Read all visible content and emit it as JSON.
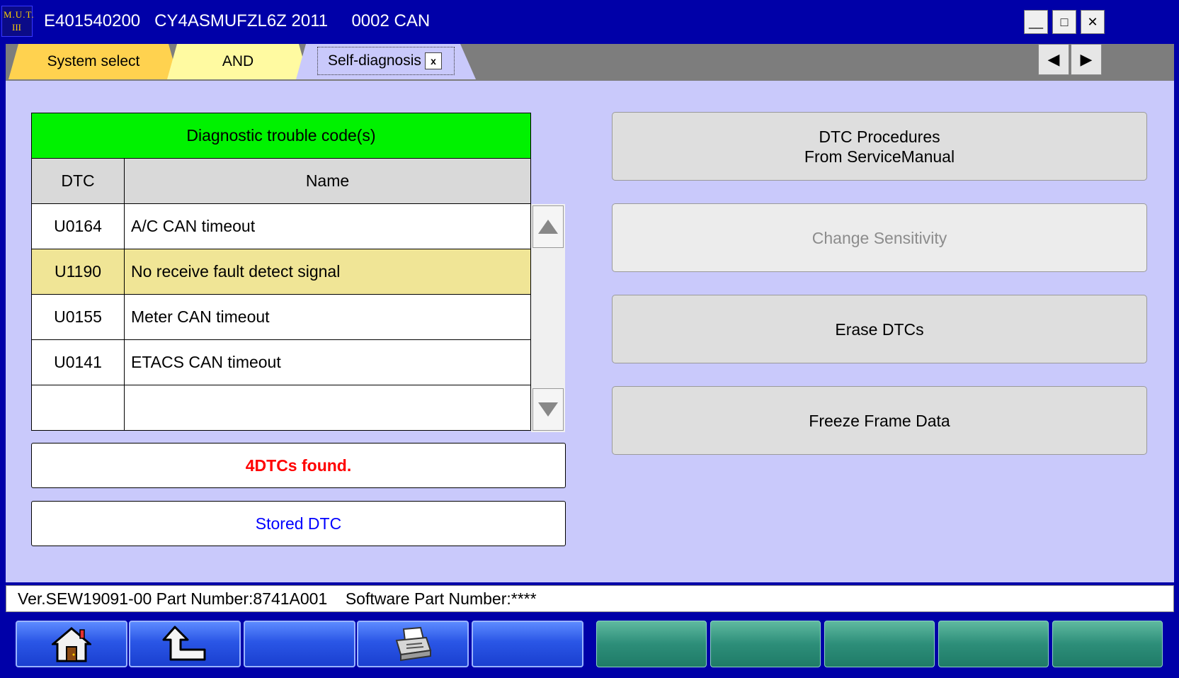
{
  "titlebar": {
    "logo_line1": "M.U.T.",
    "logo_line2": "III",
    "title": "E401540200   CY4ASMUFZL6Z 2011     0002 CAN",
    "minimize": "__",
    "maximize": "□",
    "close": "✕"
  },
  "tabs": [
    {
      "label": "System select"
    },
    {
      "label": "AND"
    },
    {
      "label": "Self-diagnosis",
      "close": "x"
    }
  ],
  "nav": {
    "prev": "◀",
    "next": "▶"
  },
  "dtc_table": {
    "title": "Diagnostic trouble code(s)",
    "headers": {
      "dtc": "DTC",
      "name": "Name"
    },
    "rows": [
      {
        "dtc": "U0164",
        "name": "A/C CAN timeout"
      },
      {
        "dtc": "U1190",
        "name": "No receive fault detect signal"
      },
      {
        "dtc": "U0155",
        "name": "Meter CAN timeout"
      },
      {
        "dtc": "U0141",
        "name": "ETACS CAN timeout"
      },
      {
        "dtc": "",
        "name": ""
      }
    ]
  },
  "status_message": "4DTCs found.",
  "stored_label": "Stored DTC",
  "actions": {
    "dtc_procedures_line1": "DTC Procedures",
    "dtc_procedures_line2": "From ServiceManual",
    "change_sensitivity": "Change Sensitivity",
    "erase_dtcs": "Erase DTCs",
    "freeze_frame": "Freeze Frame Data"
  },
  "statusbar": {
    "text": "Ver.SEW19091-00 Part Number:8741A001    Software Part Number:****"
  },
  "toolbar": {
    "icons": [
      "home-icon",
      "return-icon",
      "",
      "printer-icon",
      "",
      "",
      "",
      "",
      "",
      ""
    ]
  },
  "colors": {
    "window_blue": "#0000a8",
    "content_bg": "#c9c9fb",
    "header_green": "#00f200",
    "selected_row": "#f0e596",
    "message_red": "#ff0000",
    "stored_blue": "#0000ff"
  }
}
